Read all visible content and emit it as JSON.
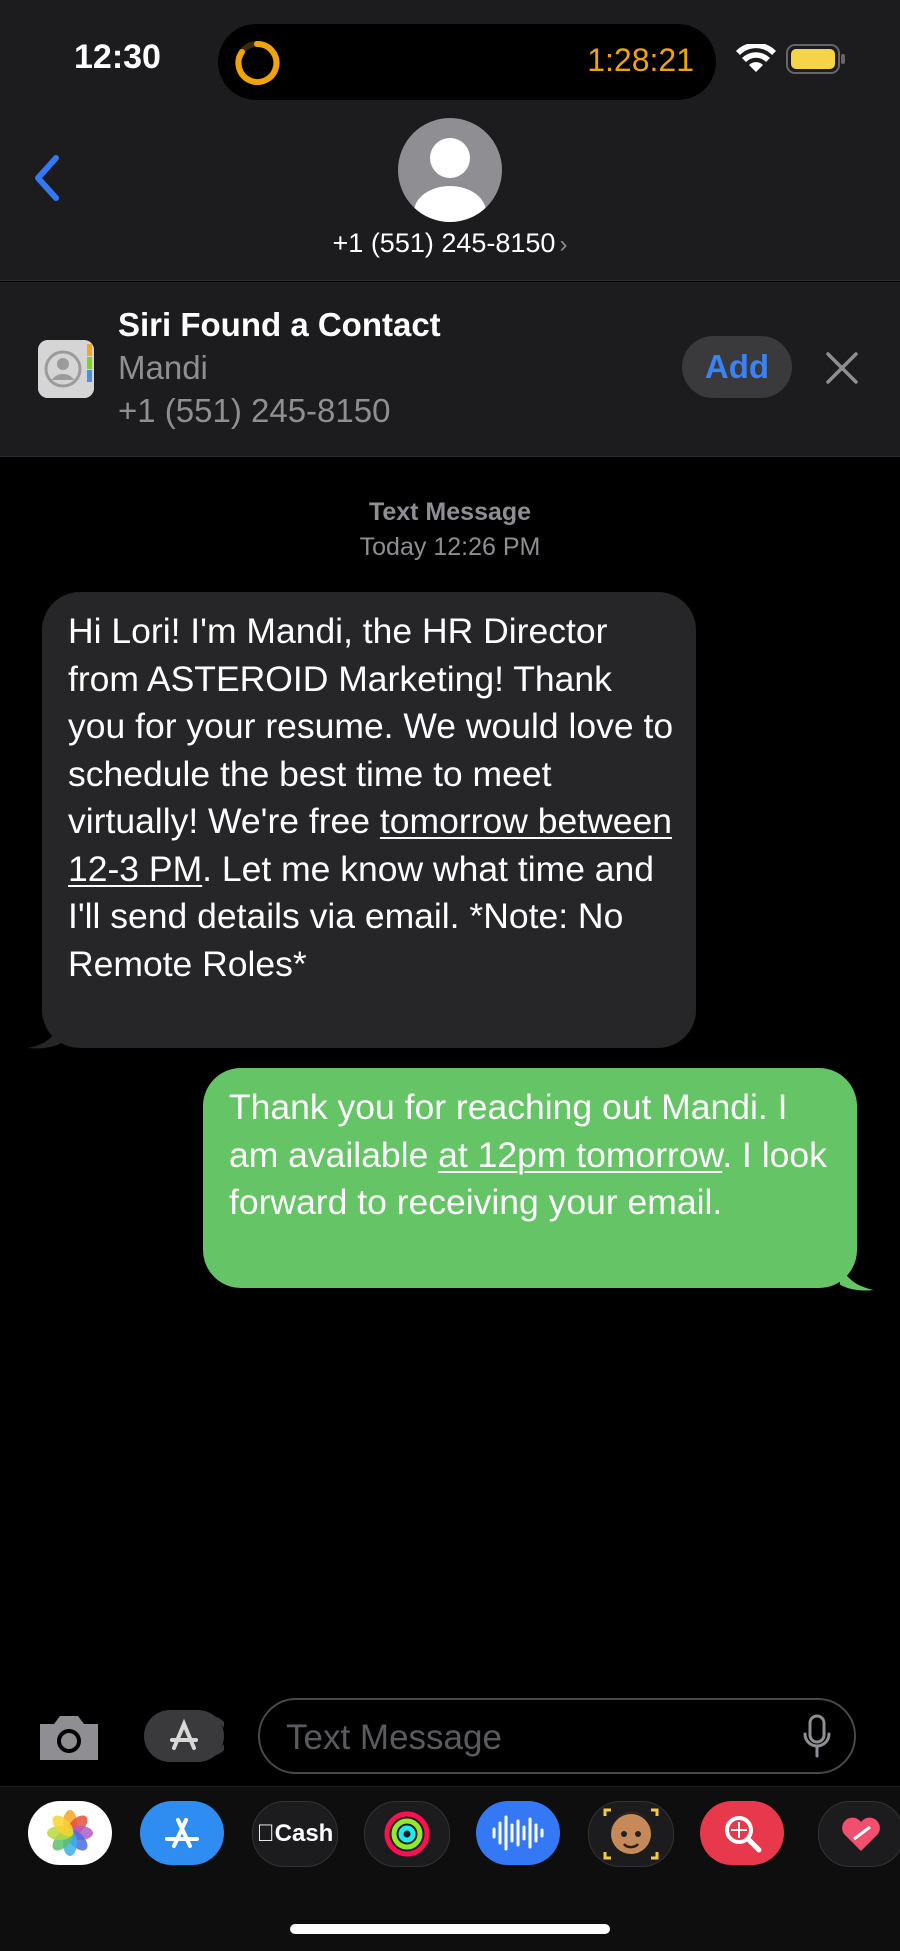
{
  "status_bar": {
    "time": "12:30",
    "timer": "1:28:21"
  },
  "header": {
    "contact": "+1 (551) 245-8150",
    "chevron": "›"
  },
  "siri": {
    "title": "Siri Found a Contact",
    "name": "Mandi",
    "phone": "+1 (551) 245-8150",
    "add_label": "Add"
  },
  "thread": {
    "meta_type": "Text Message",
    "meta_time": "Today 12:26 PM",
    "incoming": {
      "part1": "Hi Lori! I'm Mandi, the HR Director from ASTEROID Marketing! Thank you for your resume. We would love to schedule the best time to meet virtually! We're free ",
      "link": "tomorrow between 12-3 PM",
      "part2": ". Let me know what time and I'll send details via email. *Note: No Remote Roles*"
    },
    "outgoing": {
      "part1": "Thank you for reaching out Mandi. I am available ",
      "link": "at 12pm tomorrow",
      "part2": ". I look forward to receiving your email."
    }
  },
  "composer": {
    "placeholder": "Text Message"
  },
  "drawer": {
    "apps": [
      "photos-icon",
      "app-store-icon",
      "apple-cash-icon",
      "fitness-icon",
      "audio-message-icon",
      "memoji-icon",
      "search-images-icon",
      "heart-stickers-icon"
    ],
    "cash_label": "Cash"
  }
}
